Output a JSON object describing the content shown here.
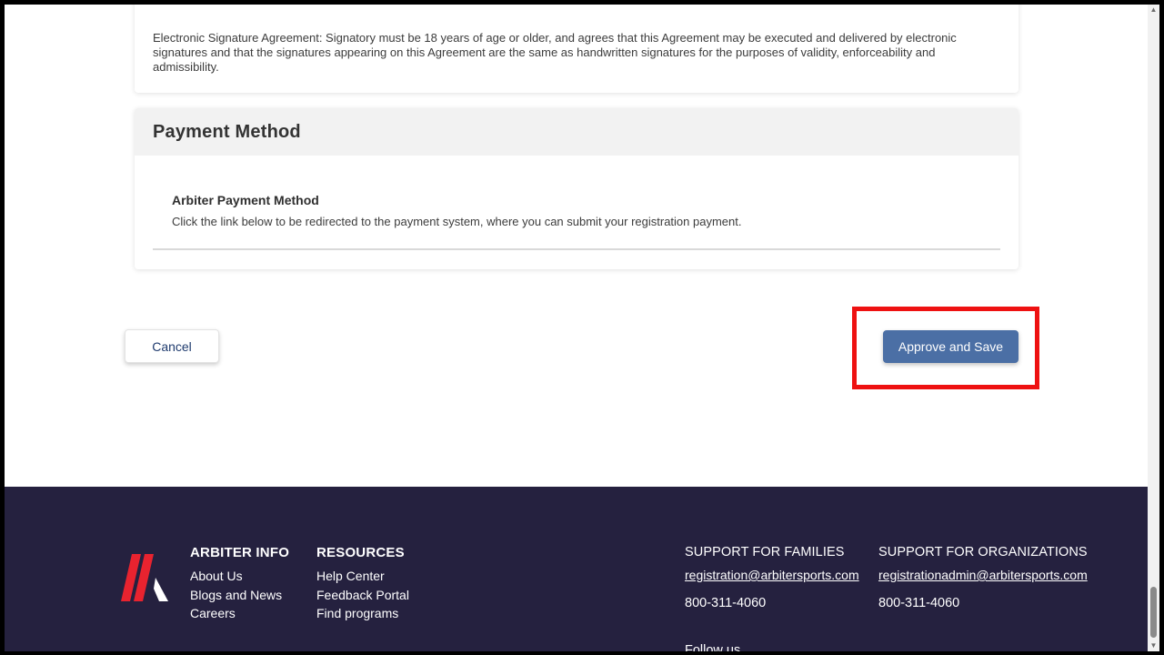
{
  "esignature": {
    "text": "Electronic Signature Agreement: Signatory must be 18 years of age or older, and agrees that this Agreement may be executed and delivered by electronic signatures and that the signatures appearing on this Agreement are the same as handwritten signatures for the purposes of validity, enforceability and admissibility."
  },
  "payment": {
    "section_title": "Payment Method",
    "method_heading": "Arbiter Payment Method",
    "method_description": "Click the link below to be redirected to the payment system, where you can submit your registration payment."
  },
  "actions": {
    "cancel_label": "Cancel",
    "approve_label": "Approve and Save"
  },
  "footer": {
    "arbiter_info": {
      "heading": "ARBITER INFO",
      "links": [
        "About Us",
        "Blogs and News",
        "Careers"
      ]
    },
    "resources": {
      "heading": "RESOURCES",
      "links": [
        "Help Center",
        "Feedback Portal",
        "Find programs"
      ]
    },
    "support_families": {
      "heading": "SUPPORT FOR FAMILIES",
      "email": "registration@arbitersports.com",
      "phone": "800-311-4060"
    },
    "support_organizations": {
      "heading": "SUPPORT FOR ORGANIZATIONS",
      "email": "registrationadmin@arbitersports.com",
      "phone": "800-311-4060"
    },
    "follow_us": "Follow us"
  },
  "colors": {
    "primary_button": "#4b6fa5",
    "footer_bg": "#25213f",
    "highlight": "#ee1111",
    "logo_red": "#e8232f"
  }
}
